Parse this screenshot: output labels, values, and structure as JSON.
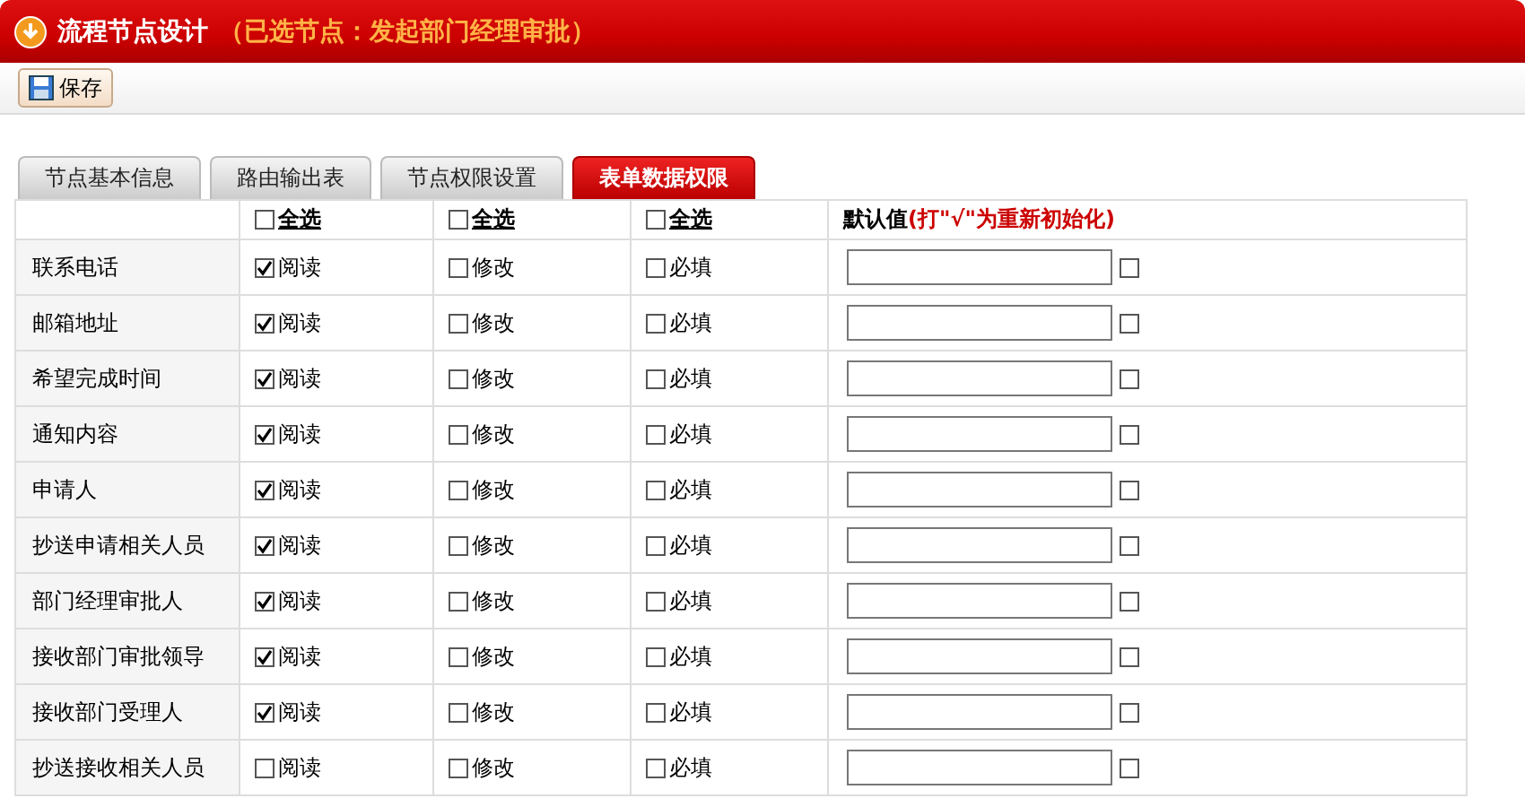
{
  "header": {
    "title": "流程节点设计",
    "subtitle": "（已选节点：发起部门经理审批）"
  },
  "toolbar": {
    "buttons": [
      "保存"
    ]
  },
  "tabs": [
    {
      "label": "节点基本信息",
      "selected": false
    },
    {
      "label": "路由输出表",
      "selected": false
    },
    {
      "label": "节点权限设置",
      "selected": false
    },
    {
      "label": "表单数据权限",
      "selected": true
    }
  ],
  "table": {
    "select_all": [
      {
        "label": "全选",
        "checked": false
      },
      {
        "label": "全选",
        "checked": false
      },
      {
        "label": "全选",
        "checked": false
      }
    ],
    "default_label": "默认值",
    "default_hint": "(打\"√\"为重新初始化)",
    "rows": [
      {
        "field": "联系电话",
        "read_label": "阅读",
        "read": true,
        "edit_label": "修改",
        "edit": false,
        "required_label": "必填",
        "required": false,
        "reinit": false
      },
      {
        "field": "邮箱地址",
        "read_label": "阅读",
        "read": true,
        "edit_label": "修改",
        "edit": false,
        "required_label": "必填",
        "required": false,
        "reinit": false
      },
      {
        "field": "希望完成时间",
        "read_label": "阅读",
        "read": true,
        "edit_label": "修改",
        "edit": false,
        "required_label": "必填",
        "required": false,
        "reinit": false
      },
      {
        "field": "通知内容",
        "read_label": "阅读",
        "read": true,
        "edit_label": "修改",
        "edit": false,
        "required_label": "必填",
        "required": false,
        "reinit": false
      },
      {
        "field": "申请人",
        "read_label": "阅读",
        "read": true,
        "edit_label": "修改",
        "edit": false,
        "required_label": "必填",
        "required": false,
        "reinit": false
      },
      {
        "field": "抄送申请相关人员",
        "read_label": "阅读",
        "read": true,
        "edit_label": "修改",
        "edit": false,
        "required_label": "必填",
        "required": false,
        "reinit": false
      },
      {
        "field": "部门经理审批人",
        "read_label": "阅读",
        "read": true,
        "edit_label": "修改",
        "edit": false,
        "required_label": "必填",
        "required": false,
        "reinit": false
      },
      {
        "field": "接收部门审批领导",
        "read_label": "阅读",
        "read": true,
        "edit_label": "修改",
        "edit": false,
        "required_label": "必填",
        "required": false,
        "reinit": false
      },
      {
        "field": "接收部门受理人",
        "read_label": "阅读",
        "read": true,
        "edit_label": "修改",
        "edit": false,
        "required_label": "必填",
        "required": false,
        "reinit": false
      },
      {
        "field": "抄送接收相关人员",
        "read_label": "阅读",
        "read": false,
        "edit_label": "修改",
        "edit": false,
        "required_label": "必填",
        "required": false,
        "reinit": false
      }
    ]
  }
}
